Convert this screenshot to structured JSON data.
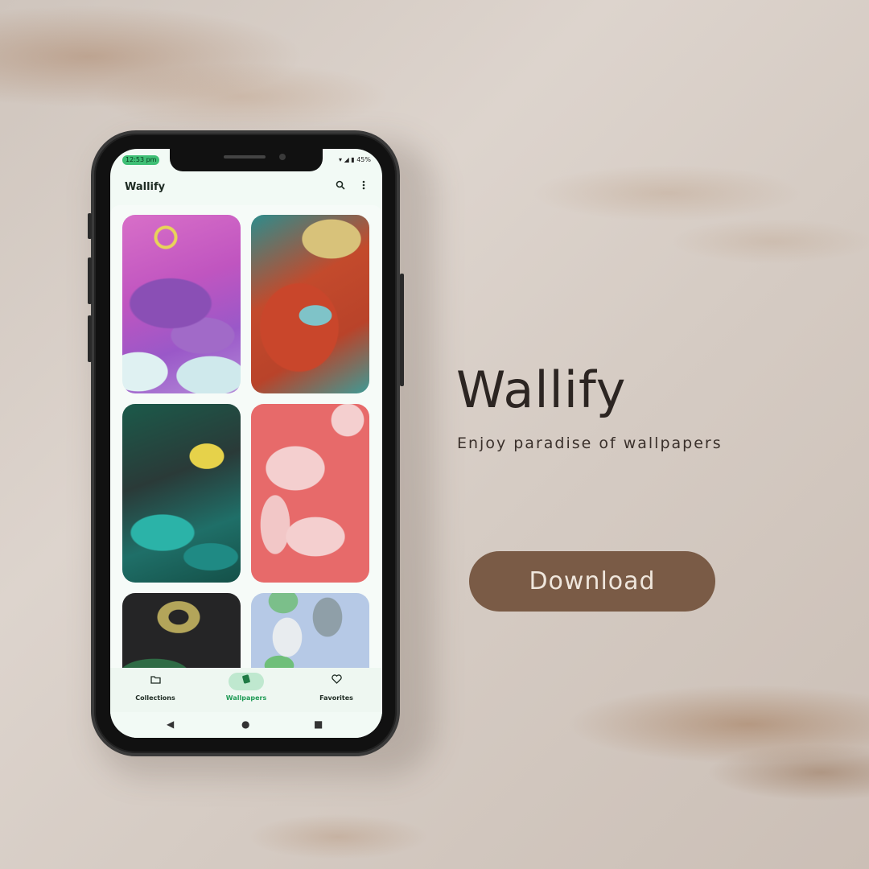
{
  "status_bar": {
    "time": "12:53 pm",
    "battery": "45%"
  },
  "app_bar": {
    "title": "Wallify",
    "search_icon": "search-icon",
    "menu_icon": "more-vert-icon"
  },
  "wallpapers": [
    {
      "name": "purple-formline-bird"
    },
    {
      "name": "red-teal-formline-face"
    },
    {
      "name": "green-formline-eye"
    },
    {
      "name": "pink-flower"
    },
    {
      "name": "dark-shapes"
    },
    {
      "name": "blue-abstract-shapes"
    }
  ],
  "bottom_nav": [
    {
      "label": "Collections",
      "icon": "folder-icon",
      "active": false
    },
    {
      "label": "Wallpapers",
      "icon": "wallpaper-icon",
      "active": true
    },
    {
      "label": "Favorites",
      "icon": "heart-icon",
      "active": false
    }
  ],
  "promo": {
    "title": "Wallify",
    "subtitle": "Enjoy paradise of wallpapers",
    "download_label": "Download"
  },
  "colors": {
    "accent_green": "#3fbf75",
    "button_brown": "#7a5b46"
  }
}
